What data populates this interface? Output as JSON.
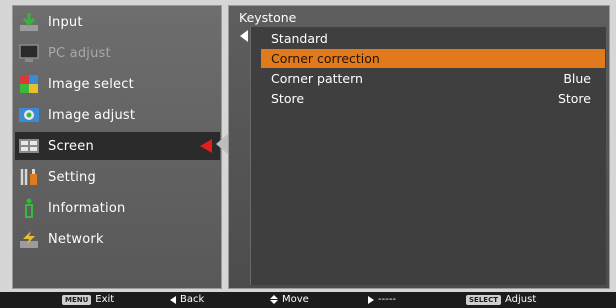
{
  "menu": {
    "items": [
      {
        "label": "Input",
        "icon": "input-icon",
        "disabled": false
      },
      {
        "label": "PC adjust",
        "icon": "pc-adjust-icon",
        "disabled": true
      },
      {
        "label": "Image select",
        "icon": "image-select-icon",
        "disabled": false
      },
      {
        "label": "Image adjust",
        "icon": "image-adjust-icon",
        "disabled": false
      },
      {
        "label": "Screen",
        "icon": "screen-icon",
        "disabled": false,
        "selected": true
      },
      {
        "label": "Setting",
        "icon": "setting-icon",
        "disabled": false
      },
      {
        "label": "Information",
        "icon": "information-icon",
        "disabled": false
      },
      {
        "label": "Network",
        "icon": "network-icon",
        "disabled": false
      }
    ]
  },
  "submenu": {
    "title": "Keystone",
    "rows": [
      {
        "label": "Standard",
        "value": ""
      },
      {
        "label": "Corner correction",
        "value": "",
        "highlight": true
      },
      {
        "label": "Corner pattern",
        "value": "Blue"
      },
      {
        "label": "Store",
        "value": "Store"
      }
    ]
  },
  "footer": {
    "exit_key": "MENU",
    "exit_label": "Exit",
    "back_label": "Back",
    "move_label": "Move",
    "right_label": "-----",
    "select_key": "SELECT",
    "select_label": "Adjust"
  },
  "colors": {
    "highlight": "#e07a1c",
    "selection_arrow": "#e31c1c"
  }
}
